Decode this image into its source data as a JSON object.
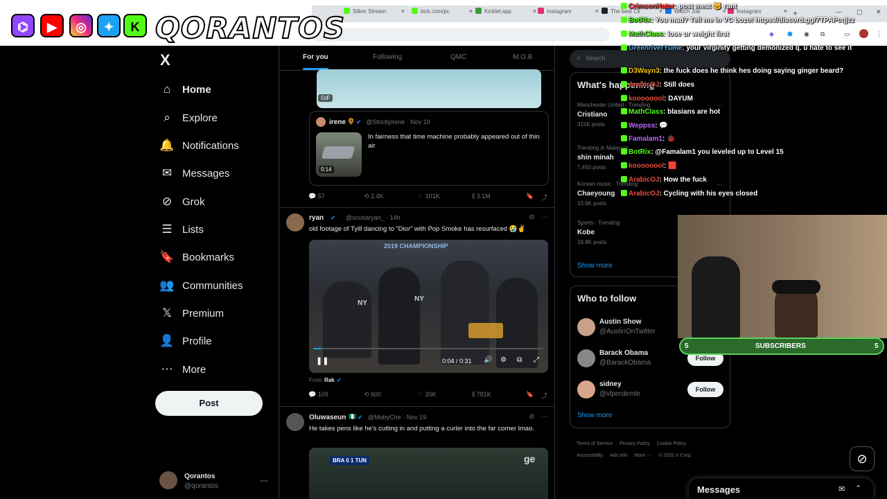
{
  "browser": {
    "tabs": [
      {
        "label": "Sliker Stream",
        "color": "#53fc18"
      },
      {
        "label": "kick.com/pc",
        "color": "#53fc18"
      },
      {
        "label": "Kicklet.app",
        "color": "#3b9a3b"
      },
      {
        "label": "Instagram",
        "color": "#e1306c"
      },
      {
        "label": "The best Cli",
        "color": "#222222"
      },
      {
        "label": "Watch Job",
        "color": "#1a73e8"
      },
      {
        "label": "Instagram",
        "color": "#e1306c"
      }
    ],
    "new_tab": "+"
  },
  "banner": {
    "text": "QORANTOS",
    "icons": [
      "twitch-icon",
      "youtube-icon",
      "instagram-icon",
      "twitter-icon",
      "kick-icon"
    ]
  },
  "nav": {
    "logo": "X",
    "items": [
      {
        "label": "Home",
        "icon": "⌂"
      },
      {
        "label": "Explore",
        "icon": "⌕"
      },
      {
        "label": "Notifications",
        "icon": "🔔"
      },
      {
        "label": "Messages",
        "icon": "✉"
      },
      {
        "label": "Grok",
        "icon": "⊘"
      },
      {
        "label": "Lists",
        "icon": "☰"
      },
      {
        "label": "Bookmarks",
        "icon": "🔖"
      },
      {
        "label": "Communities",
        "icon": "👥"
      },
      {
        "label": "Premium",
        "icon": "𝕏"
      },
      {
        "label": "Profile",
        "icon": "👤"
      },
      {
        "label": "More",
        "icon": "⋯"
      }
    ],
    "post_label": "Post",
    "account": {
      "name": "Qorantos",
      "handle": "@qorantos",
      "more": "···"
    }
  },
  "timeline": {
    "tabs": [
      "For you",
      "Following",
      "QMC",
      "M.O.B"
    ],
    "gif_label": "GIF",
    "quote": {
      "name": "irene",
      "emoji": "🌻",
      "handle": "@Strictlyirene · Nov 19",
      "text": "In fairness that time machine probably appeared out of thin air",
      "duration": "0:14"
    },
    "post1_stats": {
      "replies": "57",
      "reposts": "2.4K",
      "likes": "101K",
      "views": "3.1M"
    },
    "post2": {
      "name": "ryan",
      "handle": "@scubaryan_ · 14h",
      "text": "old footage of Tyill dancing to “Dior” with Pop Smoke has resurfaced 😭✌️",
      "time": "0:04 / 0:31",
      "banner_text": "2019 CHAMPIONSHIP",
      "jersey": "NY",
      "from_label": "From",
      "from_name": "Rak",
      "stats": {
        "replies": "109",
        "reposts": "600",
        "likes": "20K",
        "views": "781K"
      }
    },
    "post3": {
      "name": "Oluwaseun",
      "flag": "🇳🇬",
      "handle": "@MobyChe · Nov 19",
      "text": "He takes pens like he's cutting in and putting a curler into the far corner lmao.",
      "score": "BRA 0 1 TUN",
      "channel": "ge"
    }
  },
  "right": {
    "search_placeholder": "Search",
    "trends_title": "What's happening",
    "trends": [
      {
        "cat": "Manchester United · Trending",
        "name": "Cristiano",
        "count": "315K posts"
      },
      {
        "cat": "Trending in Malaysia",
        "name": "shin minah",
        "count": "7,450 posts"
      },
      {
        "cat": "Korean music · Trending",
        "name": "Chaeyoung",
        "count": "15.6K posts"
      },
      {
        "cat": "Sports · Trending",
        "name": "Kobe",
        "count": "18.8K posts"
      }
    ],
    "show_more": "Show more",
    "wtf_title": "Who to follow",
    "follows": [
      {
        "name": "Austin Show",
        "handle": "@AustinOnTwitter"
      },
      {
        "name": "Barack Obama",
        "handle": "@BarackObama"
      },
      {
        "name": "sidney",
        "handle": "@vlperdemle"
      }
    ],
    "follow_label": "Follow",
    "footer": [
      "Terms of Service",
      "Privacy Policy",
      "Cookie Policy",
      "Accessibility",
      "Ads info",
      "More ···",
      "© 2025 X Corp."
    ]
  },
  "chat": [
    {
      "user": "CrimsonHater",
      "color": "#ff3333",
      "msg": ": post meat 🐱 rant"
    },
    {
      "user": "BotRix",
      "color": "#53fc18",
      "msg": ": You mad? Tell me in VC bozo! https://discord.gg/7TPAPcqjzz"
    },
    {
      "user": "MathClass",
      "color": "#53fc18",
      "msg": ": lose ur weight first"
    },
    {
      "user": "GreenriverYume",
      "color": "#5dade2",
      "msg": ": your virginity getting demonized q. u hate to see it"
    },
    {
      "user": "D3Wayn3",
      "color": "#f1c40f",
      "msg": ": the fuck does he think hes doing saying ginger beard?"
    },
    {
      "user": "ArabicOJ",
      "color": "#e74c3c",
      "msg": ": Still does"
    },
    {
      "user": "koooooool",
      "color": "#e74c3c",
      "msg": ": DAYUM"
    },
    {
      "user": "MathClass",
      "color": "#53fc18",
      "msg": ": blasians are hot"
    },
    {
      "user": "Weppss",
      "color": "#bb66ff",
      "msg": ": 💬"
    },
    {
      "user": "Famalam1",
      "color": "#bb66ff",
      "msg": ": 🐞"
    },
    {
      "user": "BotRix",
      "color": "#53fc18",
      "msg": ": @Famalam1 you leveled up to Level 15"
    },
    {
      "user": "koooooool",
      "color": "#e74c3c",
      "msg": ": 🟥"
    },
    {
      "user": "ArabicOJ",
      "color": "#e74c3c",
      "msg": ": How the fuck"
    },
    {
      "user": "ArabicOJ",
      "color": "#e74c3c",
      "msg": ": Cycling with his eyes closed"
    }
  ],
  "subs": {
    "left": "5",
    "label": "SUBSCRIBERS",
    "right": "5"
  },
  "dock": {
    "label": "Messages"
  }
}
